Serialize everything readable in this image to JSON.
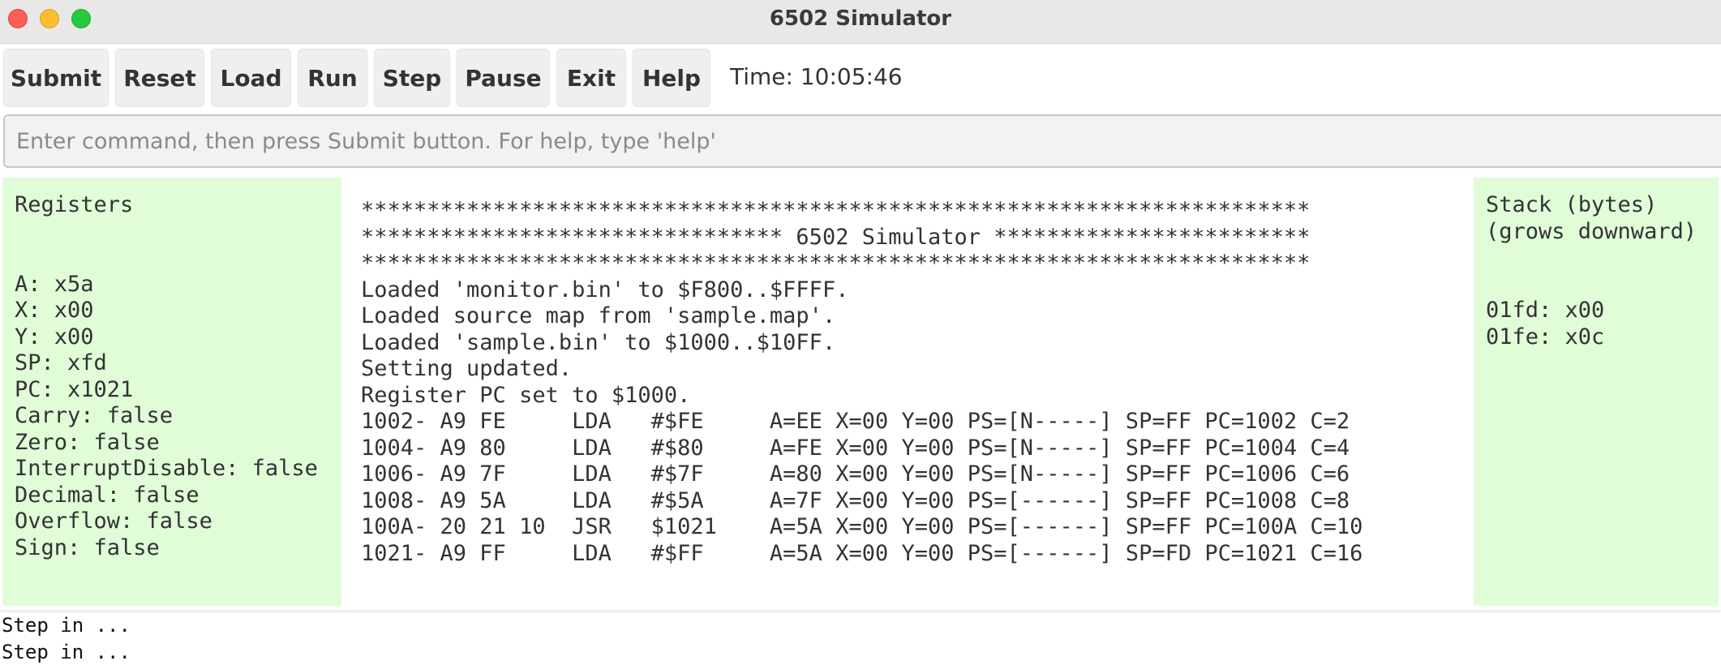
{
  "window": {
    "title": "6502 Simulator"
  },
  "toolbar": {
    "buttons": [
      "Submit",
      "Reset",
      "Load",
      "Run",
      "Step",
      "Pause",
      "Exit",
      "Help"
    ],
    "time_label": "Time: 10:05:46"
  },
  "command": {
    "placeholder": "Enter command, then press Submit button. For help, type 'help'",
    "value": ""
  },
  "registers": {
    "title": "Registers",
    "lines": [
      "A: x5a",
      "X: x00",
      "Y: x00",
      "SP: xfd",
      "PC: x1021",
      "Carry: false",
      "Zero: false",
      "InterruptDisable: false",
      "Decimal: false",
      "Overflow: false",
      "Sign: false"
    ]
  },
  "console": {
    "lines": [
      "************************************************************************",
      "******************************** 6502 Simulator ************************",
      "************************************************************************",
      "Loaded 'monitor.bin' to $F800..$FFFF.",
      "Loaded source map from 'sample.map'.",
      "Loaded 'sample.bin' to $1000..$10FF.",
      "Setting updated.",
      "Register PC set to $1000.",
      "1002- A9 FE     LDA   #$FE     A=EE X=00 Y=00 PS=[N-----] SP=FF PC=1002 C=2",
      "1004- A9 80     LDA   #$80     A=FE X=00 Y=00 PS=[N-----] SP=FF PC=1004 C=4",
      "1006- A9 7F     LDA   #$7F     A=80 X=00 Y=00 PS=[N-----] SP=FF PC=1006 C=6",
      "1008- A9 5A     LDA   #$5A     A=7F X=00 Y=00 PS=[------] SP=FF PC=1008 C=8",
      "100A- 20 21 10  JSR   $1021    A=5A X=00 Y=00 PS=[------] SP=FF PC=100A C=10",
      "1021- A9 FF     LDA   #$FF     A=5A X=00 Y=00 PS=[------] SP=FD PC=1021 C=16"
    ]
  },
  "stack": {
    "title_line1": "Stack (bytes)",
    "title_line2": "(grows downward)",
    "lines": [
      "01fd: x00",
      "01fe: x0c"
    ]
  },
  "log": {
    "lines": [
      "Step in ...",
      "Step in ..."
    ]
  }
}
